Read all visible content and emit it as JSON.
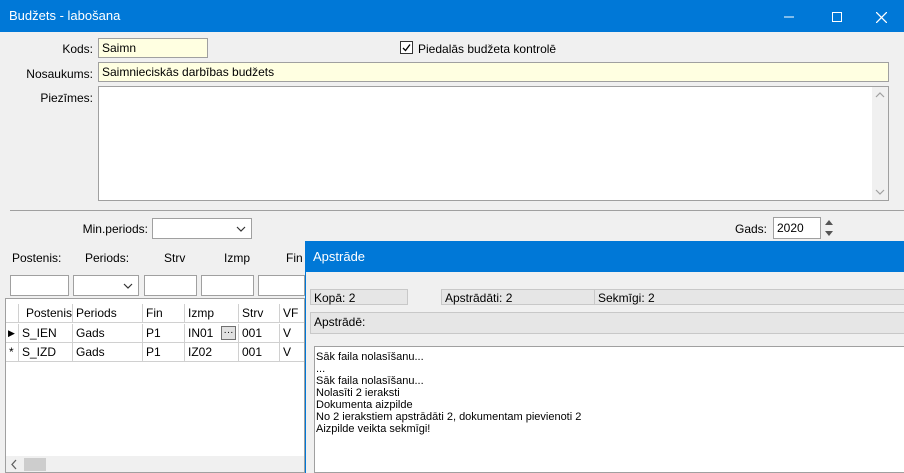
{
  "window": {
    "title": "Budžets - labošana",
    "minimize_icon": "minimize-icon",
    "maximize_icon": "maximize-icon",
    "close_icon": "close-icon"
  },
  "form": {
    "kods_label": "Kods:",
    "kods_value": "Saimn",
    "piedalas_label": "Piedalās budžeta kontrolē",
    "piedalas_checked": true,
    "nosaukums_label": "Nosaukums:",
    "nosaukums_value": "Saimnieciskās darbības budžets",
    "piezimes_label": "Piezīmes:",
    "piezimes_value": "",
    "min_periods_label": "Min.periods:",
    "min_periods_value": "",
    "gads_label": "Gads:",
    "gads_value": "2020"
  },
  "filters": {
    "postenis": "Postenis:",
    "periods": "Periods:",
    "strv": "Strv",
    "izmp": "Izmp",
    "fin": "Fin"
  },
  "grid": {
    "columns": [
      "Postenis",
      "Periods",
      "Fin",
      "Izmp",
      "Strv",
      "VF"
    ],
    "rows": [
      {
        "marker": "▶",
        "cells": [
          "S_IEN",
          "Gads",
          "P1",
          "IN01",
          "001",
          "V"
        ]
      },
      {
        "marker": "*",
        "cells": [
          "S_IZD",
          "Gads",
          "P1",
          "IZ02",
          "001",
          "V"
        ]
      }
    ],
    "ellipsis": "···"
  },
  "dialog": {
    "title": "Apstrāde",
    "kopa": "Kopā: 2",
    "apstradati": "Apstrādāti: 2",
    "sekmigi": "Sekmīgi: 2",
    "apstrade_label": "Apstrādē:",
    "log": [
      "Sāk faila nolasīšanu...",
      "...",
      "Sāk faila nolasīšanu...",
      "Nolasīti 2 ieraksti",
      "Dokumenta aizpilde",
      "No 2 ierakstiem apstrādāti 2, dokumentam pievienoti 2",
      "Aizpilde veikta sekmīgi!"
    ]
  }
}
